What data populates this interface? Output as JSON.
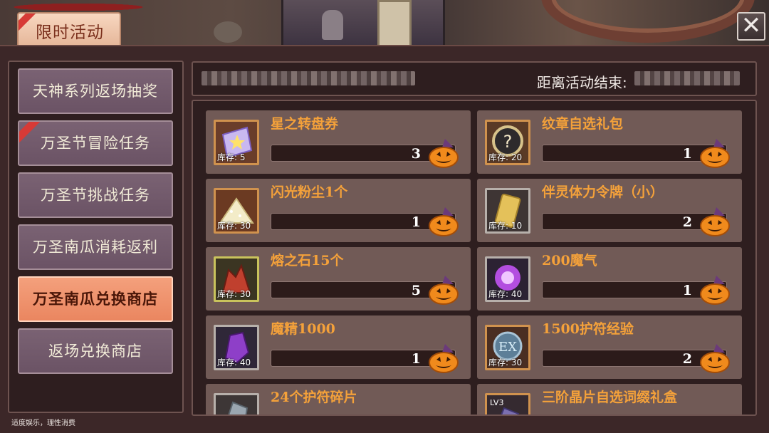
{
  "header": {
    "tab_label": "限时活动",
    "close_label": "✕"
  },
  "sidebar": {
    "items": [
      {
        "label": "天神系列返场抽奖",
        "active": false,
        "ribbon": false
      },
      {
        "label": "万圣节冒险任务",
        "active": false,
        "ribbon": true
      },
      {
        "label": "万圣节挑战任务",
        "active": false,
        "ribbon": false
      },
      {
        "label": "万圣南瓜消耗返利",
        "active": false,
        "ribbon": false
      },
      {
        "label": "万圣南瓜兑换商店",
        "active": true,
        "ribbon": false
      },
      {
        "label": "返场兑换商店",
        "active": false,
        "ribbon": false
      }
    ]
  },
  "topbar": {
    "end_label": "距离活动结束:"
  },
  "shop": {
    "items": [
      {
        "name": "星之转盘券",
        "stock": "库存: 5",
        "cost": "3",
        "icon": "star-ticket-icon"
      },
      {
        "name": "纹章自选礼包",
        "stock": "库存: 20",
        "cost": "1",
        "icon": "emblem-box-icon"
      },
      {
        "name": "闪光粉尘1个",
        "stock": "库存: 30",
        "cost": "1",
        "icon": "sparkle-dust-icon"
      },
      {
        "name": "伴灵体力令牌（小）",
        "stock": "库存: 10",
        "cost": "2",
        "icon": "stamina-token-icon"
      },
      {
        "name": "熔之石15个",
        "stock": "库存: 30",
        "cost": "5",
        "icon": "molten-stone-icon"
      },
      {
        "name": "200魔气",
        "stock": "库存: 40",
        "cost": "1",
        "icon": "magic-aura-icon"
      },
      {
        "name": "魔精1000",
        "stock": "库存: 40",
        "cost": "1",
        "icon": "magic-crystal-icon"
      },
      {
        "name": "1500护符经验",
        "stock": "库存: 30",
        "cost": "2",
        "icon": "ex-orb-icon"
      },
      {
        "name": "24个护符碎片",
        "stock": "",
        "cost": "",
        "icon": "talisman-shard-icon"
      },
      {
        "name": "三阶晶片自选词缀礼盒",
        "stock": "",
        "cost": "",
        "icon": "lv3-chip-box-icon"
      }
    ],
    "currency_icon": "pumpkin-icon"
  },
  "footer": {
    "note": "适度娱乐，理性消费"
  }
}
